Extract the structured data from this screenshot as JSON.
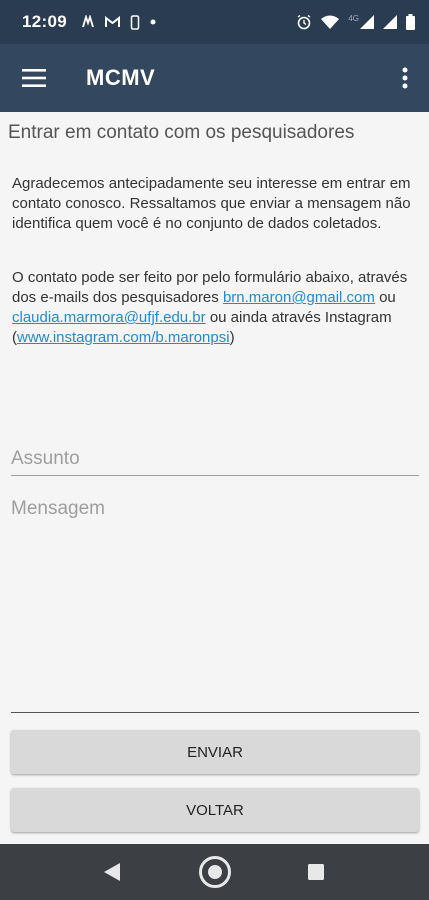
{
  "status_bar": {
    "time": "12:09",
    "network_label": "4G",
    "icons": [
      "notification-icon",
      "gmail-icon",
      "phone-icon",
      "dot-icon",
      "alarm-icon",
      "wifi-icon",
      "signal-icon",
      "signal-icon",
      "battery-icon"
    ]
  },
  "app_bar": {
    "title": "MCMV",
    "menu_icon": "hamburger-menu-icon",
    "overflow_icon": "more-vert-icon"
  },
  "page": {
    "heading": "Entrar em contato com os pesquisadores",
    "paragraph1": " Agradecemos antecipadamente seu interesse em entrar em contato conosco. Ressaltamos que enviar a mensagem não identifica quem você é no conjunto de dados coletados.",
    "paragraph2_intro": " O contato pode ser feito por pelo formulário abaixo, através dos e-mails dos pesquisadores ",
    "email1": "brn.maron@gmail.com",
    "connector1": " ou ",
    "email2": "claudia.marmora@ufjf.edu.br",
    "connector2": " ou ainda através Instagram (",
    "instagram": "www.instagram.com/b.maronpsi",
    "closing": ")"
  },
  "form": {
    "subject_placeholder": "Assunto",
    "subject_value": "",
    "message_placeholder": "Mensagem",
    "message_value": "",
    "send_label": "ENVIAR",
    "back_label": "VOLTAR"
  },
  "nav_bar": {
    "back_icon": "back-triangle-icon",
    "home_icon": "home-circle-icon",
    "recents_icon": "recents-square-icon"
  },
  "colors": {
    "status_bar": "#2a3c52",
    "app_bar": "#33475e",
    "link": "#1f8bd6",
    "button": "#d9d9d9",
    "nav_bar": "#3c3f43"
  }
}
